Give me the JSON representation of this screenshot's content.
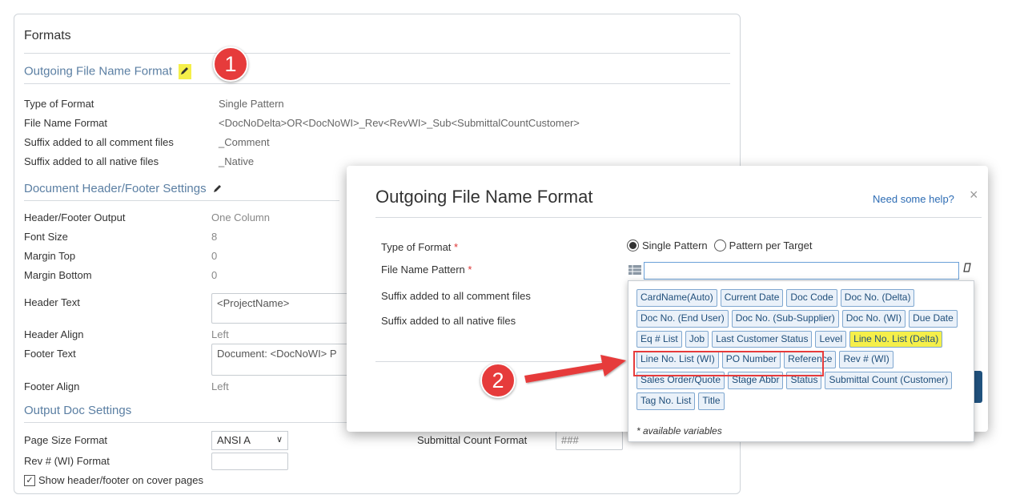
{
  "panel": {
    "title": "Formats",
    "outgoing": {
      "heading": "Outgoing File Name Format",
      "rows": [
        {
          "label": "Type of Format",
          "value": "Single Pattern"
        },
        {
          "label": "File Name Format",
          "value": "<DocNoDelta>OR<DocNoWI>_Rev<RevWI>_Sub<SubmittalCountCustomer>"
        },
        {
          "label": "Suffix added to all comment files",
          "value": "_Comment"
        },
        {
          "label": "Suffix added to all native files",
          "value": "_Native"
        }
      ]
    },
    "header_footer": {
      "heading": "Document Header/Footer Settings",
      "output_label": "Header/Footer Output",
      "output_value": "One Column",
      "font_label": "Font Size",
      "font_value": "8",
      "mtop_label": "Margin Top",
      "mtop_value": "0",
      "mbottom_label": "Margin Bottom",
      "mbottom_value": "0",
      "htext_label": "Header Text",
      "htext_value": "<ProjectName>",
      "halign_label": "Header Align",
      "halign_value": "Left",
      "ftext_label": "Footer Text",
      "ftext_value": "Document: <DocNoWI> P",
      "falign_label": "Footer Align",
      "falign_value": "Left"
    },
    "output_doc": {
      "heading": "Output Doc Settings",
      "page_size_label": "Page Size Format",
      "page_size_value": "ANSI A",
      "submittal_label": "Submittal Count Format",
      "submittal_value": "###",
      "rev_label": "Rev # (WI) Format",
      "rev_value": "",
      "cover_label": "Show header/footer on cover pages"
    }
  },
  "badges": {
    "one": "1",
    "two": "2"
  },
  "modal": {
    "title": "Outgoing File Name Format",
    "help": "Need some help?",
    "close": "×",
    "type_label": "Type of Format",
    "pattern_label": "File Name Pattern",
    "comment_label": "Suffix added to all comment files",
    "native_label": "Suffix added to all native files",
    "required_mark": "*",
    "radio_single": "Single Pattern",
    "radio_target": "Pattern per Target",
    "pattern_value": ""
  },
  "variables": {
    "chips": [
      "CardName(Auto)",
      "Current Date",
      "Doc Code",
      "Doc No. (Delta)",
      "Doc No. (End User)",
      "Doc No. (Sub-Supplier)",
      "Doc No. (WI)",
      "Due Date",
      "Eq # List",
      "Job",
      "Last Customer Status",
      "Level",
      "Line No. List (Delta)",
      "Line No. List (WI)",
      "PO Number",
      "Reference",
      "Rev # (WI)",
      "Sales Order/Quote",
      "Stage Abbr",
      "Status",
      "Submittal Count (Customer)",
      "Tag No. List",
      "Title"
    ],
    "footnote": "* available variables"
  },
  "colors": {
    "accent": "#5b7fa3",
    "highlight": "#f5ef4a",
    "badge": "#e63b3b",
    "chip_border": "#7fa7d0"
  }
}
